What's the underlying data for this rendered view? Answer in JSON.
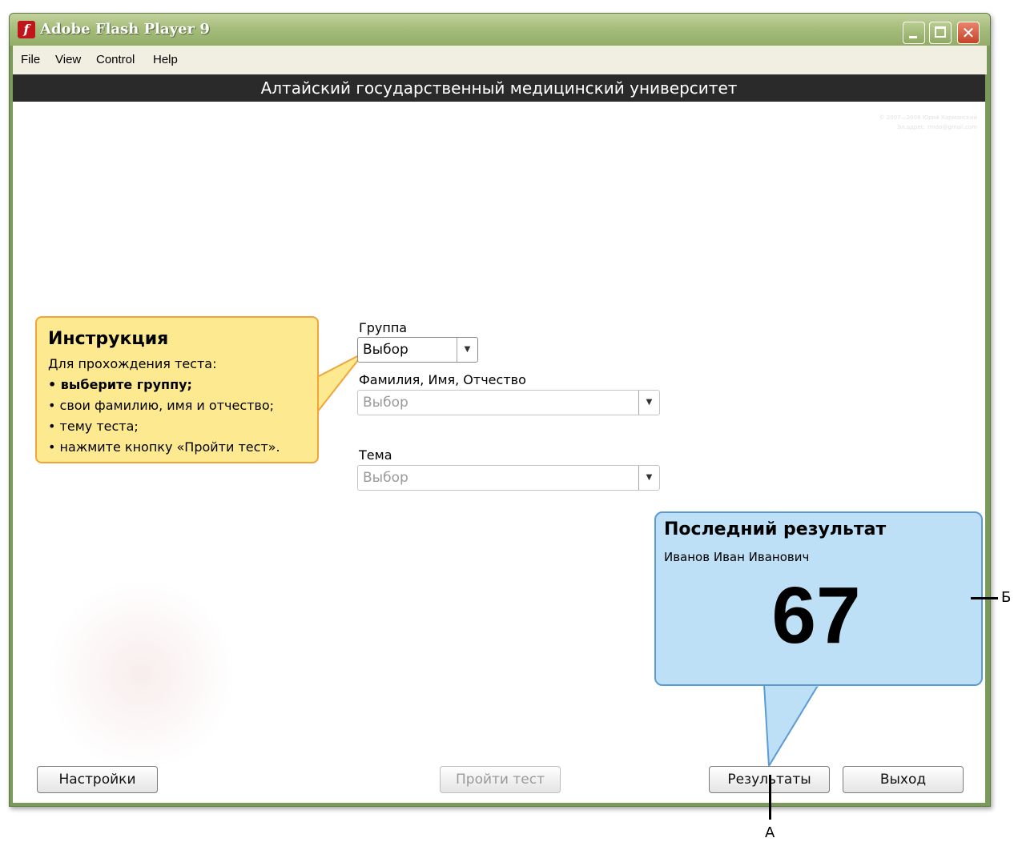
{
  "window": {
    "title": "Adobe Flash Player 9",
    "app_icon_glyph": "f",
    "controls": {
      "minimize": "minimize-icon",
      "maximize": "maximize-icon",
      "close": "close-icon",
      "close_glyph": "✕"
    }
  },
  "menu": [
    "File",
    "View",
    "Control",
    "Help"
  ],
  "header": {
    "title": "Алтайский государственный медицинский университет"
  },
  "copyright": {
    "line1": "© 2007—2008 Юрий Карманский",
    "line2": "Эл.адрес: rmdo@gmail.com"
  },
  "instructions": {
    "title": "Инструкция",
    "intro": "Для прохождения теста:",
    "steps": [
      "• выберите группу;",
      "• свои фамилию, имя и отчество;",
      "• тему теста;",
      "• нажмите кнопку «Пройти тест»."
    ]
  },
  "form": {
    "group": {
      "label": "Группа",
      "value": "Выбор"
    },
    "name": {
      "label": "Фамилия, Имя, Отчество",
      "value": "Выбор"
    },
    "topic": {
      "label": "Тема",
      "value": "Выбор"
    },
    "arrow": "▼"
  },
  "last_result": {
    "title": "Последний результат",
    "name": "Иванов Иван Иванович",
    "score": "67"
  },
  "buttons": {
    "settings": "Настройки",
    "start": "Пройти тест",
    "results": "Результаты",
    "exit": "Выход"
  },
  "annotations": {
    "a": "А",
    "b": "Б"
  },
  "colors": {
    "titlebar": "#93ad68",
    "header_band": "#2a2a2a",
    "instruction_bg": "#fde98f",
    "instruction_border": "#f0a43a",
    "result_bg": "#bde0f6",
    "result_border": "#5b9bd5"
  }
}
